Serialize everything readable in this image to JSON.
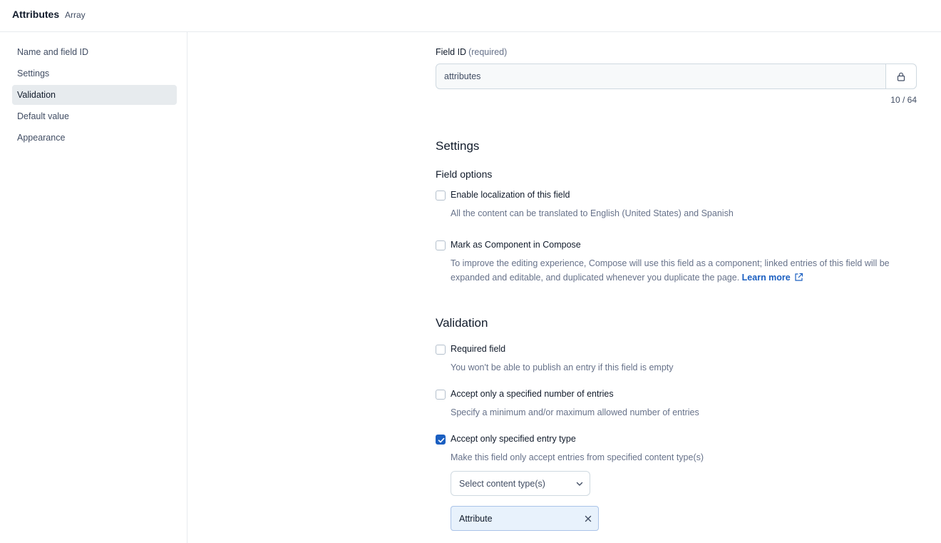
{
  "header": {
    "title": "Attributes",
    "subtitle": "Array"
  },
  "sidebar": {
    "items": [
      {
        "label": "Name and field ID"
      },
      {
        "label": "Settings"
      },
      {
        "label": "Validation"
      },
      {
        "label": "Default value"
      },
      {
        "label": "Appearance"
      }
    ],
    "active": "Validation"
  },
  "field_id": {
    "label": "Field ID",
    "required_hint": "(required)",
    "value": "attributes",
    "counter": "10 / 64"
  },
  "settings": {
    "title": "Settings",
    "field_options_title": "Field options",
    "options": [
      {
        "label": "Enable localization of this field",
        "help": "All the content can be translated to English (United States) and Spanish",
        "checked": false
      },
      {
        "label": "Mark as Component in Compose",
        "help": "To improve the editing experience, Compose will use this field as a component; linked entries of this field will be expanded and editable, and duplicated whenever you duplicate the page.",
        "link": "Learn more",
        "checked": false
      }
    ]
  },
  "validation": {
    "title": "Validation",
    "options": [
      {
        "label": "Required field",
        "help": "You won't be able to publish an entry if this field is empty",
        "checked": false
      },
      {
        "label": "Accept only a specified number of entries",
        "help": "Specify a minimum and/or maximum allowed number of entries",
        "checked": false
      },
      {
        "label": "Accept only specified entry type",
        "help": "Make this field only accept entries from specified content type(s)",
        "checked": true
      }
    ],
    "select_placeholder": "Select content type(s)",
    "selected_types": [
      "Attribute"
    ]
  },
  "colors": {
    "accent": "#1b5fc1",
    "pill_bg": "#e8f2fc",
    "active_nav": "#e7ebee"
  }
}
